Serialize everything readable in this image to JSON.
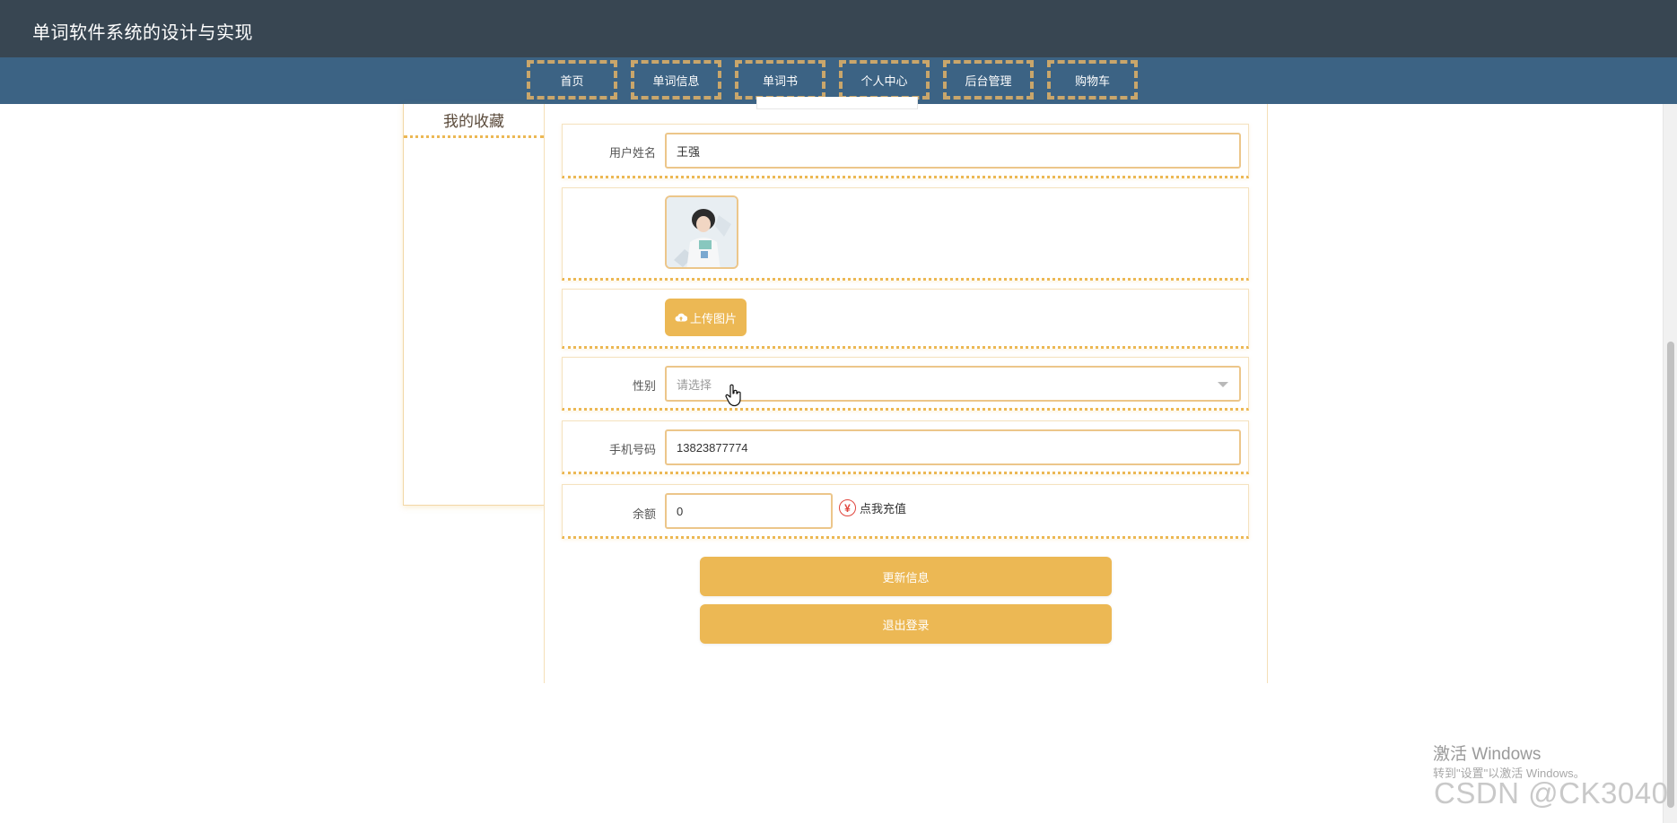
{
  "app": {
    "title": "单词软件系统的设计与实现"
  },
  "nav": {
    "items": [
      {
        "label": "首页"
      },
      {
        "label": "单词信息"
      },
      {
        "label": "单词书"
      },
      {
        "label": "个人中心"
      },
      {
        "label": "后台管理"
      },
      {
        "label": "购物车"
      }
    ]
  },
  "sidebar": {
    "items": [
      {
        "label": "我的收藏"
      }
    ]
  },
  "form": {
    "username": {
      "label": "用户姓名",
      "value": "王强"
    },
    "avatar": {
      "alt": "avatar"
    },
    "upload": {
      "label": "上传图片",
      "icon": "cloud-upload-icon"
    },
    "gender": {
      "label": "性别",
      "placeholder": "请选择"
    },
    "phone": {
      "label": "手机号码",
      "value": "13823877774"
    },
    "balance": {
      "label": "余额",
      "value": "0",
      "recharge_label": "点我充值",
      "icon": "yen-icon"
    },
    "update_button": "更新信息",
    "logout_button": "退出登录"
  },
  "watermark": {
    "line1": "激活 Windows",
    "line2": "转到\"设置\"以激活 Windows。",
    "csdn": "CSDN @CK3040"
  },
  "colors": {
    "topbar": "#384652",
    "navbar": "#3c6384",
    "accent": "#ecb854",
    "nav_border": "#c9a66b"
  }
}
